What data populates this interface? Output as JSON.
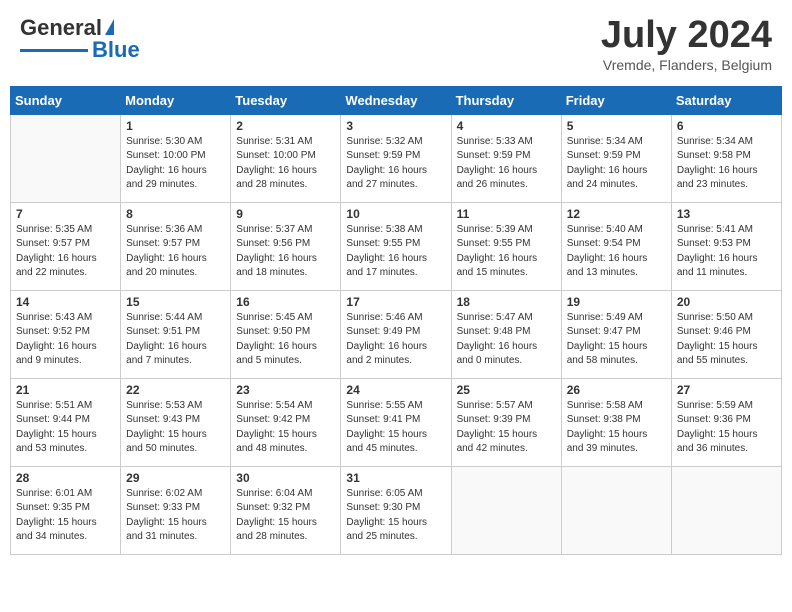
{
  "logo": {
    "general": "General",
    "blue": "Blue"
  },
  "header": {
    "month": "July 2024",
    "location": "Vremde, Flanders, Belgium"
  },
  "weekdays": [
    "Sunday",
    "Monday",
    "Tuesday",
    "Wednesday",
    "Thursday",
    "Friday",
    "Saturday"
  ],
  "weeks": [
    [
      {
        "day": "",
        "info": ""
      },
      {
        "day": "1",
        "info": "Sunrise: 5:30 AM\nSunset: 10:00 PM\nDaylight: 16 hours\nand 29 minutes."
      },
      {
        "day": "2",
        "info": "Sunrise: 5:31 AM\nSunset: 10:00 PM\nDaylight: 16 hours\nand 28 minutes."
      },
      {
        "day": "3",
        "info": "Sunrise: 5:32 AM\nSunset: 9:59 PM\nDaylight: 16 hours\nand 27 minutes."
      },
      {
        "day": "4",
        "info": "Sunrise: 5:33 AM\nSunset: 9:59 PM\nDaylight: 16 hours\nand 26 minutes."
      },
      {
        "day": "5",
        "info": "Sunrise: 5:34 AM\nSunset: 9:59 PM\nDaylight: 16 hours\nand 24 minutes."
      },
      {
        "day": "6",
        "info": "Sunrise: 5:34 AM\nSunset: 9:58 PM\nDaylight: 16 hours\nand 23 minutes."
      }
    ],
    [
      {
        "day": "7",
        "info": "Sunrise: 5:35 AM\nSunset: 9:57 PM\nDaylight: 16 hours\nand 22 minutes."
      },
      {
        "day": "8",
        "info": "Sunrise: 5:36 AM\nSunset: 9:57 PM\nDaylight: 16 hours\nand 20 minutes."
      },
      {
        "day": "9",
        "info": "Sunrise: 5:37 AM\nSunset: 9:56 PM\nDaylight: 16 hours\nand 18 minutes."
      },
      {
        "day": "10",
        "info": "Sunrise: 5:38 AM\nSunset: 9:55 PM\nDaylight: 16 hours\nand 17 minutes."
      },
      {
        "day": "11",
        "info": "Sunrise: 5:39 AM\nSunset: 9:55 PM\nDaylight: 16 hours\nand 15 minutes."
      },
      {
        "day": "12",
        "info": "Sunrise: 5:40 AM\nSunset: 9:54 PM\nDaylight: 16 hours\nand 13 minutes."
      },
      {
        "day": "13",
        "info": "Sunrise: 5:41 AM\nSunset: 9:53 PM\nDaylight: 16 hours\nand 11 minutes."
      }
    ],
    [
      {
        "day": "14",
        "info": "Sunrise: 5:43 AM\nSunset: 9:52 PM\nDaylight: 16 hours\nand 9 minutes."
      },
      {
        "day": "15",
        "info": "Sunrise: 5:44 AM\nSunset: 9:51 PM\nDaylight: 16 hours\nand 7 minutes."
      },
      {
        "day": "16",
        "info": "Sunrise: 5:45 AM\nSunset: 9:50 PM\nDaylight: 16 hours\nand 5 minutes."
      },
      {
        "day": "17",
        "info": "Sunrise: 5:46 AM\nSunset: 9:49 PM\nDaylight: 16 hours\nand 2 minutes."
      },
      {
        "day": "18",
        "info": "Sunrise: 5:47 AM\nSunset: 9:48 PM\nDaylight: 16 hours\nand 0 minutes."
      },
      {
        "day": "19",
        "info": "Sunrise: 5:49 AM\nSunset: 9:47 PM\nDaylight: 15 hours\nand 58 minutes."
      },
      {
        "day": "20",
        "info": "Sunrise: 5:50 AM\nSunset: 9:46 PM\nDaylight: 15 hours\nand 55 minutes."
      }
    ],
    [
      {
        "day": "21",
        "info": "Sunrise: 5:51 AM\nSunset: 9:44 PM\nDaylight: 15 hours\nand 53 minutes."
      },
      {
        "day": "22",
        "info": "Sunrise: 5:53 AM\nSunset: 9:43 PM\nDaylight: 15 hours\nand 50 minutes."
      },
      {
        "day": "23",
        "info": "Sunrise: 5:54 AM\nSunset: 9:42 PM\nDaylight: 15 hours\nand 48 minutes."
      },
      {
        "day": "24",
        "info": "Sunrise: 5:55 AM\nSunset: 9:41 PM\nDaylight: 15 hours\nand 45 minutes."
      },
      {
        "day": "25",
        "info": "Sunrise: 5:57 AM\nSunset: 9:39 PM\nDaylight: 15 hours\nand 42 minutes."
      },
      {
        "day": "26",
        "info": "Sunrise: 5:58 AM\nSunset: 9:38 PM\nDaylight: 15 hours\nand 39 minutes."
      },
      {
        "day": "27",
        "info": "Sunrise: 5:59 AM\nSunset: 9:36 PM\nDaylight: 15 hours\nand 36 minutes."
      }
    ],
    [
      {
        "day": "28",
        "info": "Sunrise: 6:01 AM\nSunset: 9:35 PM\nDaylight: 15 hours\nand 34 minutes."
      },
      {
        "day": "29",
        "info": "Sunrise: 6:02 AM\nSunset: 9:33 PM\nDaylight: 15 hours\nand 31 minutes."
      },
      {
        "day": "30",
        "info": "Sunrise: 6:04 AM\nSunset: 9:32 PM\nDaylight: 15 hours\nand 28 minutes."
      },
      {
        "day": "31",
        "info": "Sunrise: 6:05 AM\nSunset: 9:30 PM\nDaylight: 15 hours\nand 25 minutes."
      },
      {
        "day": "",
        "info": ""
      },
      {
        "day": "",
        "info": ""
      },
      {
        "day": "",
        "info": ""
      }
    ]
  ]
}
